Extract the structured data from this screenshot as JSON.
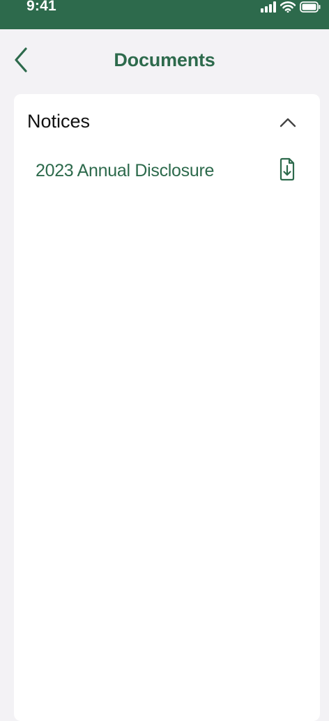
{
  "status_bar": {
    "time": "9:41",
    "background_color": "#2d6a4c",
    "icons": [
      "signal-icon",
      "wifi-icon",
      "battery-icon"
    ]
  },
  "header": {
    "title": "Documents",
    "back_icon": "chevron-left-icon",
    "accent_color": "#2d6a4c"
  },
  "sections": [
    {
      "title": "Notices",
      "expanded": true,
      "toggle_icon": "chevron-up-icon",
      "items": [
        {
          "label": "2023 Annual Disclosure",
          "icon": "file-download-icon"
        }
      ]
    }
  ]
}
